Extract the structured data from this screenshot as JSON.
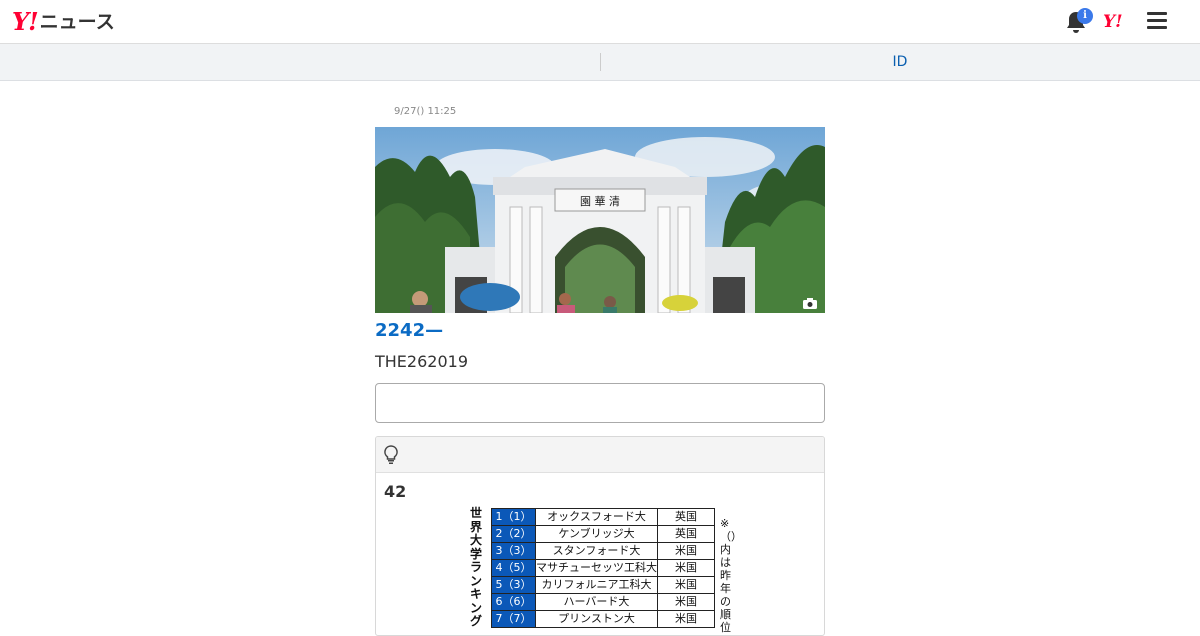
{
  "header": {
    "logo_y": "Y!",
    "logo_text": "ニュース",
    "notification_badge": "i",
    "yahoo_mini": "Y!"
  },
  "subnav": {
    "id_label": "ID"
  },
  "article": {
    "date": "9/27() 11:25",
    "title": "2242—",
    "lead": "THE262019"
  },
  "hint": {
    "number": "42"
  },
  "ranking": {
    "title": "世界大学ランキング",
    "note": "※（）内は昨年の順位",
    "rows": [
      {
        "rank": "1（1）",
        "name": "オックスフォード大",
        "country": "英国"
      },
      {
        "rank": "2（2）",
        "name": "ケンブリッジ大",
        "country": "英国"
      },
      {
        "rank": "3（3）",
        "name": "スタンフォード大",
        "country": "米国"
      },
      {
        "rank": "4（5）",
        "name": "マサチューセッツ工科大",
        "country": "米国"
      },
      {
        "rank": "5（3）",
        "name": "カリフォルニア工科大",
        "country": "米国"
      },
      {
        "rank": "6（6）",
        "name": "ハーバード大",
        "country": "米国"
      },
      {
        "rank": "7（7）",
        "name": "プリンストン大",
        "country": "米国"
      }
    ]
  },
  "colors": {
    "brand_red": "#ff0033",
    "link_blue": "#0b6bc4",
    "rank_blue": "#0b58b8",
    "badge_blue": "#3b79ea"
  }
}
